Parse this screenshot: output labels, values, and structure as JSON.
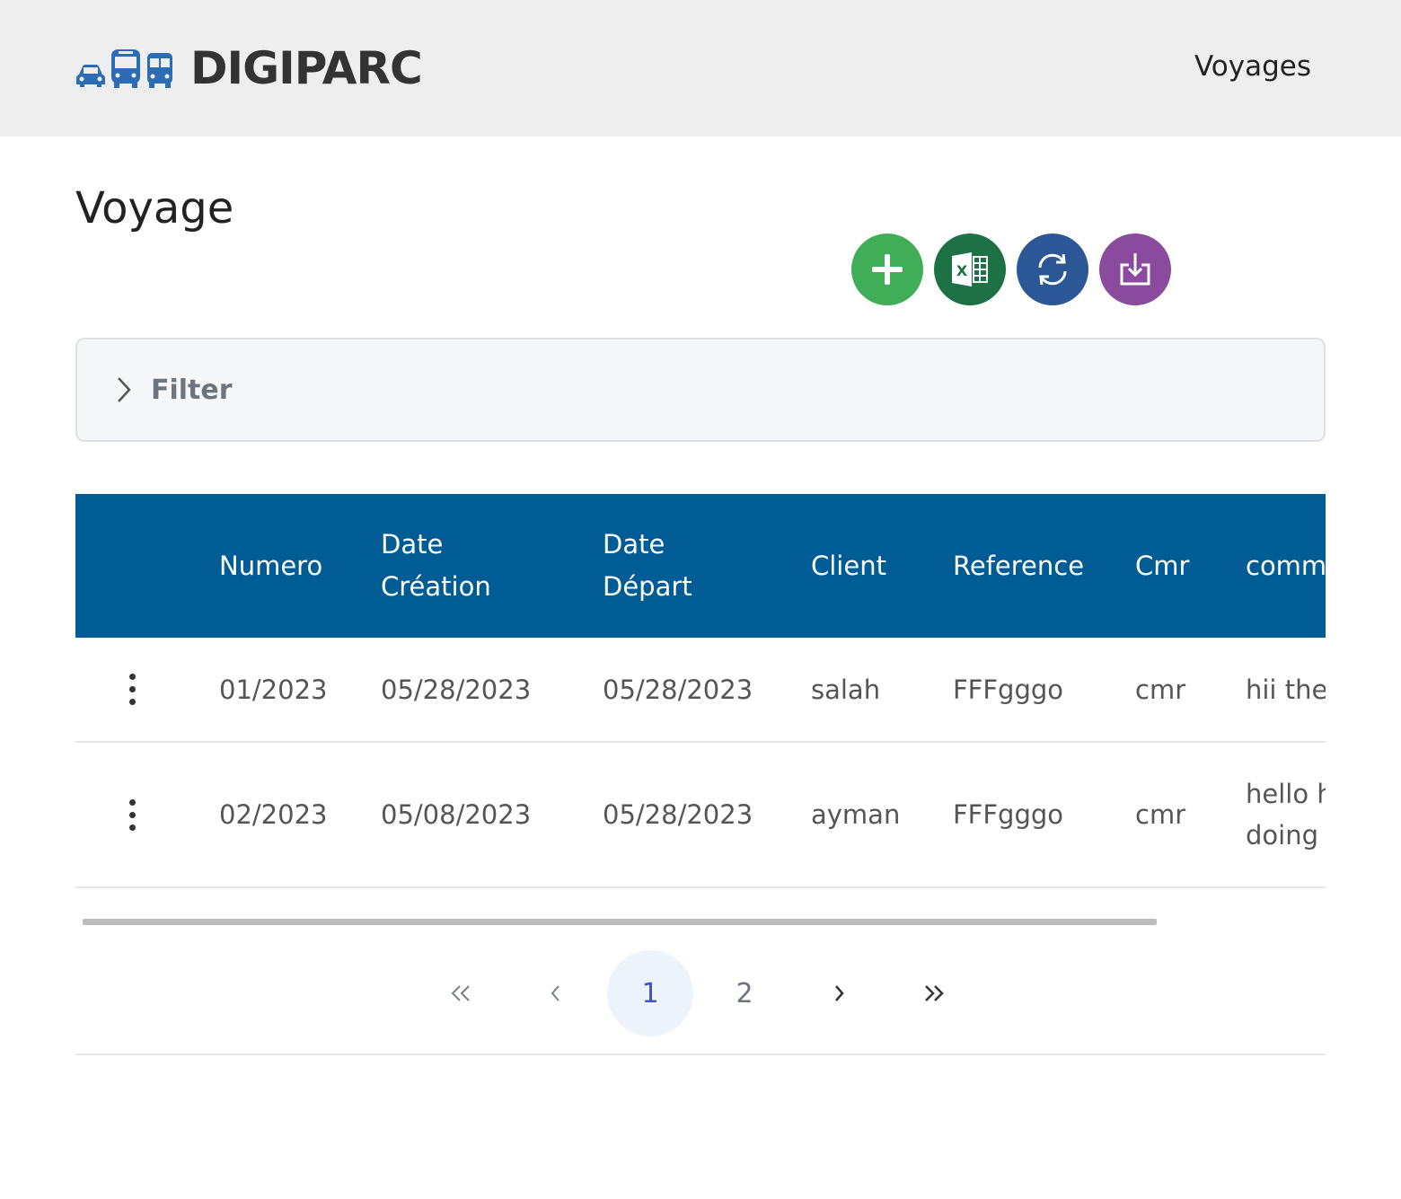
{
  "header": {
    "brand": "DIGIPARC",
    "nav_link": "Voyages",
    "brand_color": "#2a6db5"
  },
  "page": {
    "title": "Voyage"
  },
  "actions": [
    {
      "name": "add",
      "icon": "plus-icon",
      "color": "#3fae56"
    },
    {
      "name": "excel-export",
      "icon": "excel-icon",
      "color": "#1e7145"
    },
    {
      "name": "refresh",
      "icon": "refresh-icon",
      "color": "#2b5797"
    },
    {
      "name": "import",
      "icon": "download-icon",
      "color": "#8a4b9e"
    }
  ],
  "filter": {
    "label": "Filter"
  },
  "table": {
    "header_color": "#005c94",
    "columns": {
      "numero": "Numero",
      "date_creation_1": "Date",
      "date_creation_2": "Création",
      "date_depart_1": "Date",
      "date_depart_2": "Départ",
      "client": "Client",
      "reference": "Reference",
      "cmr": "Cmr",
      "comment": "comm"
    },
    "rows": [
      {
        "numero": "01/2023",
        "date_creation": "05/28/2023",
        "date_depart": "05/28/2023",
        "client": "salah",
        "reference": "FFFgggo",
        "cmr": "cmr",
        "comment_1": "hii the",
        "comment_2": ""
      },
      {
        "numero": "02/2023",
        "date_creation": "05/08/2023",
        "date_depart": "05/28/2023",
        "client": "ayman",
        "reference": "FFFgggo",
        "cmr": "cmr",
        "comment_1": "hello h",
        "comment_2": "doing"
      }
    ]
  },
  "pagination": {
    "first": "«",
    "prev": "‹",
    "pages": [
      "1",
      "2"
    ],
    "current": "1",
    "next": "›",
    "last": "»"
  }
}
